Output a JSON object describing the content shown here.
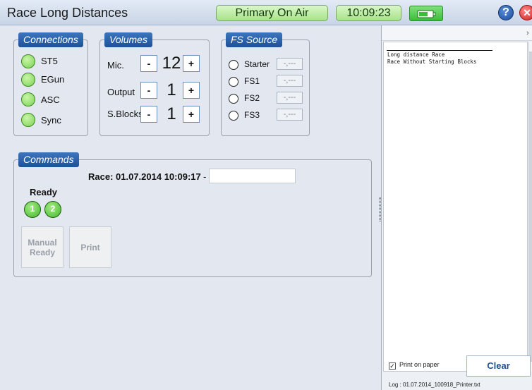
{
  "app": {
    "title": "Race Long Distances"
  },
  "status": {
    "on_air": "Primary On Air",
    "clock": "10:09:23",
    "help_glyph": "?",
    "close_glyph": "✕"
  },
  "colors": {
    "indicator_green": "#7ad352",
    "tag_blue": "#1d5199",
    "pill_green": "#a7e38a",
    "battery_green": "#3bbd3a"
  },
  "connections": {
    "title": "Connections",
    "items": [
      {
        "label": "ST5"
      },
      {
        "label": "EGun"
      },
      {
        "label": "ASC"
      },
      {
        "label": "Sync"
      }
    ]
  },
  "volumes": {
    "title": "Volumes",
    "items": [
      {
        "label": "Mic.",
        "minus": "-",
        "value": "12",
        "plus": "+"
      },
      {
        "label": "Output",
        "minus": "-",
        "value": "1",
        "plus": "+"
      },
      {
        "label": "S.Blocks",
        "minus": "-",
        "value": "1",
        "plus": "+"
      }
    ]
  },
  "fs_source": {
    "title": "FS Source",
    "items": [
      {
        "label": "Starter",
        "value": "-,---"
      },
      {
        "label": "FS1",
        "value": "-,---"
      },
      {
        "label": "FS2",
        "value": "-,---"
      },
      {
        "label": "FS3",
        "value": "-,---"
      }
    ]
  },
  "commands": {
    "title": "Commands",
    "race_label": "Race: 01.07.2014 10:09:17",
    "race_dash": "-",
    "race_input_value": "",
    "ready_label": "Ready",
    "leds": [
      "1",
      "2"
    ],
    "manual_ready": "Manual Ready",
    "print": "Print"
  },
  "printer": {
    "chevron": "›",
    "lines": [
      "Long distance Race",
      "Race Without Starting Blocks"
    ],
    "print_on_paper_label": "Print on paper",
    "print_on_paper_checked": true,
    "check_glyph": "✓",
    "clear_label": "Clear",
    "log_file": "Log : 01.07.2014_100918_Printer.txt"
  }
}
